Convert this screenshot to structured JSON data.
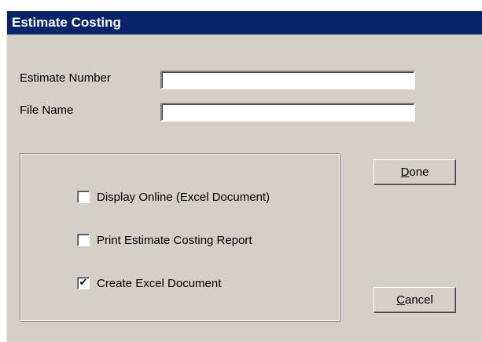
{
  "window": {
    "title": "Estimate Costing"
  },
  "fields": {
    "estimate_number": {
      "label": "Estimate Number",
      "value": ""
    },
    "file_name": {
      "label": "File Name",
      "value": ""
    }
  },
  "options": [
    {
      "label": "Display Online (Excel Document)",
      "checked": false
    },
    {
      "label": "Print Estimate Costing Report",
      "checked": false
    },
    {
      "label": "Create Excel Document",
      "checked": true
    }
  ],
  "buttons": {
    "done": {
      "mnemonic": "D",
      "rest": "one"
    },
    "cancel": {
      "mnemonic": "C",
      "rest": "ancel"
    }
  },
  "check_glyph": "✔"
}
